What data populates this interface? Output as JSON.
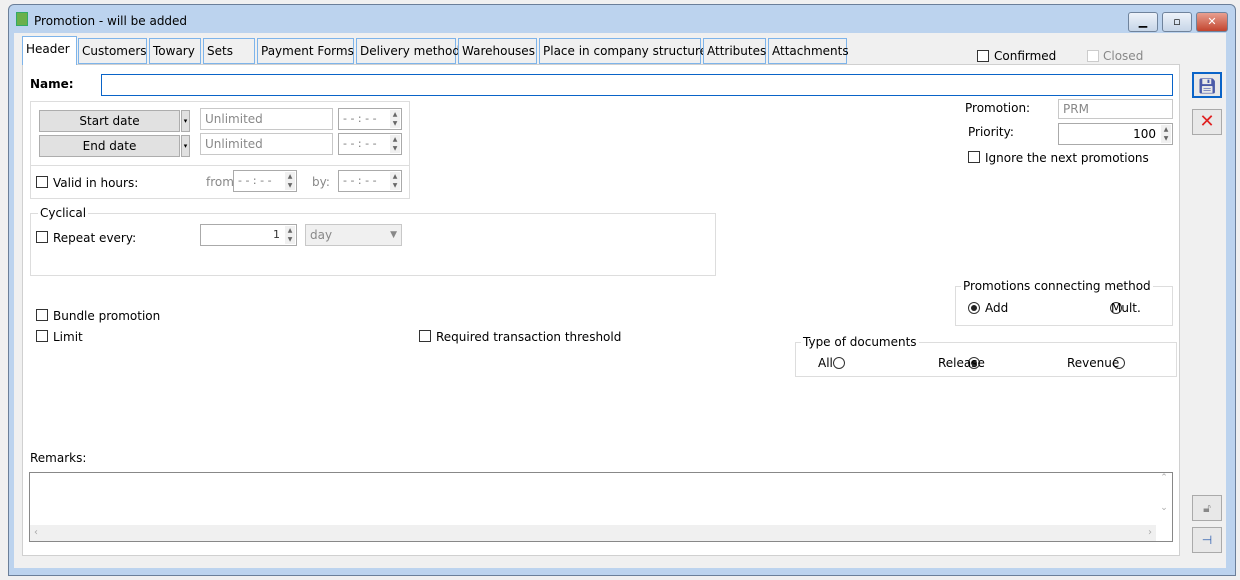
{
  "window": {
    "title": "Promotion - will be added",
    "icon": "app-icon",
    "controls": [
      "minimize-icon",
      "maximize-icon",
      "close-icon"
    ]
  },
  "tabs": [
    {
      "label": "Header",
      "active": true
    },
    {
      "label": "Customers"
    },
    {
      "label": "Towary"
    },
    {
      "label": "Sets"
    },
    {
      "label": "Payment Forms"
    },
    {
      "label": "Delivery method"
    },
    {
      "label": "Warehouses"
    },
    {
      "label": "Place in company structure"
    },
    {
      "label": "Attributes"
    },
    {
      "label": "Attachments"
    }
  ],
  "status": {
    "confirmed": "Confirmed",
    "closed": "Closed"
  },
  "form": {
    "name_label": "Name:",
    "name_value": "",
    "start_date": "Start date",
    "end_date": "End date",
    "start_value": "Unlimited",
    "end_value": "Unlimited",
    "time_placeholder": "- - : - -",
    "valid_hours": "Valid in hours:",
    "from": "from",
    "by": "by:",
    "cyclical": "Cyclical",
    "repeat_every": "Repeat every:",
    "repeat_value": "1",
    "repeat_unit": "day",
    "bundle": "Bundle promotion",
    "limit": "Limit",
    "threshold": "Required transaction threshold",
    "promotion_label": "Promotion:",
    "promotion_value": "PRM",
    "priority_label": "Priority:",
    "priority_value": "100",
    "ignore_next": "Ignore the next promotions",
    "connecting": {
      "title": "Promotions connecting method",
      "options": [
        "Add",
        "Mult."
      ],
      "selected": "Add"
    },
    "doc_types": {
      "title": "Type of documents",
      "options": [
        "All",
        "Release",
        "Revenue"
      ],
      "selected": "Release"
    },
    "remarks_label": "Remarks:",
    "remarks_value": ""
  },
  "side_buttons": [
    "save-icon",
    "cancel-icon",
    "lock-icon",
    "pin-icon"
  ]
}
